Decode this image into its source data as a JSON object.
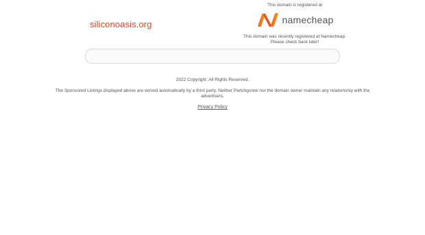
{
  "domain": {
    "name": "siliconoasis.org",
    "color": "#e8442a"
  },
  "registrar": {
    "registered_at_text": "This domain is registered at",
    "logo_name": "namecheap",
    "logo_icon": "namecheap-n-icon",
    "recent_text": "This domain was recently registered at Namecheap.",
    "check_back_text": "Please check back later!",
    "brand_color": "#f26522"
  },
  "search": {
    "placeholder": ""
  },
  "footer": {
    "copyright": "2022 Copyright. All Rights Reserved.",
    "disclaimer": "The Sponsored Listings displayed above are served automatically by a third party. Neither Parkingcrew nor the domain owner maintain any relationship with the advertisers.",
    "privacy_label": "Privacy Policy"
  }
}
